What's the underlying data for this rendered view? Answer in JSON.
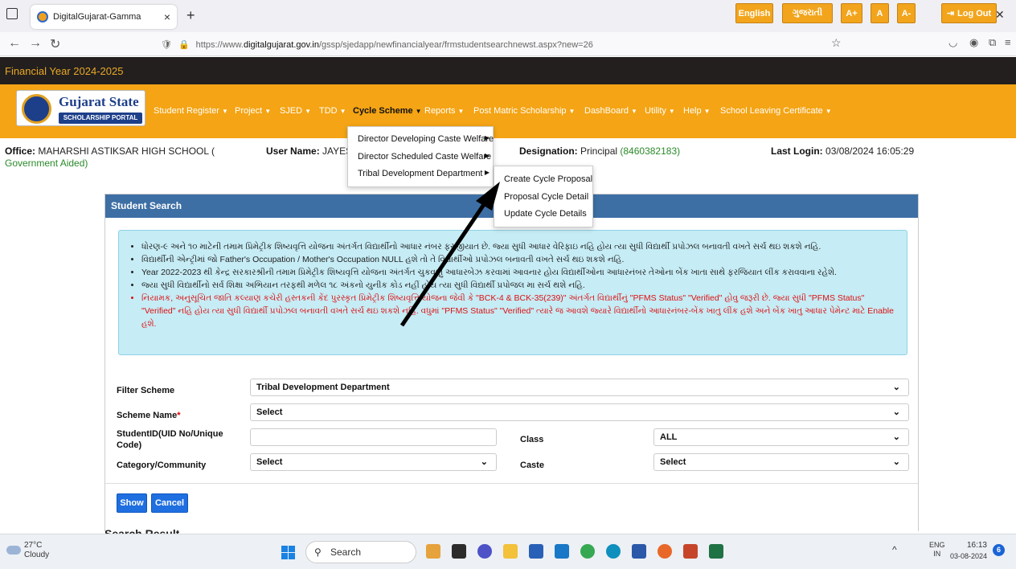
{
  "browser": {
    "tab_title": "DigitalGujarat-Gamma",
    "tab_close": "×",
    "new_tab": "+",
    "url_prefix": "https://www.",
    "url_domain": "digitalgujarat.gov.in",
    "url_path": "/gssp/sjedapp/newfinancialyear/frmstudentsearchnewst.aspx?new=26"
  },
  "topbar": {
    "financial_year": "Financial Year 2024-2025",
    "buttons": [
      "English",
      "ગુજરાતી",
      "A+",
      "A",
      "A-",
      "Log Out"
    ]
  },
  "logo": {
    "line1": "Gujarat State",
    "line2": "SCHOLARSHIP PORTAL"
  },
  "menu": [
    "Student Register",
    "Project",
    "SJED",
    "TDD",
    "Cycle Scheme",
    "Reports",
    "Post Matric Scholarship",
    "DashBoard",
    "Utility",
    "Help",
    "School Leaving Certificate"
  ],
  "dropdown_cycle": [
    "Director Developing Caste Welfare",
    "Director Scheduled Caste Welfare",
    "Tribal Development Department"
  ],
  "dropdown_tribal": [
    "Create Cycle Proposal",
    "Proposal Cycle Detail",
    "Update Cycle Details"
  ],
  "info": {
    "office_label": "Office:",
    "office_value": "MAHARSHI ASTIKSAR HIGH SCHOOL (",
    "office_type": "Government Aided)",
    "user_label": "User Name:",
    "user_value": "JAYESH",
    "designation_label": "Designation:",
    "designation_value": "Principal",
    "designation_phone": "(8460382183)",
    "last_login_label": "Last Login:",
    "last_login_value": "03/08/2024 16:05:29"
  },
  "panel": {
    "title": "Student Search",
    "notices": [
      "ધોરણ-૯ અને ૧૦ માટેની તમામ પ્રિમેટ્રીક શિષ્યવૃત્તિ યોજના અંતર્ગત વિદ્યાર્થીનો આધાર નંબર ફરજીયાત છે. જ્યા સુધી આધાર વેરિફાઇ નહિ હોય ત્યા સુધી વિદ્યાર્થી પ્રપોઝલ બનાવતી વખતે સર્ચ થઇ શકશે નહિ.",
      "વિદ્યાર્થીની એન્ટ્રીમાં જો Father's Occupation / Mother's Occupation NULL હશે તો તે વિદ્યાર્થીઓ પ્રપોઝલ બનાવતી વખતે સર્ચ થઇ શકશે નહિ.",
      "Year 2022-2023 થી કેન્દ્ર સરકારશ્રીની તમામ પ્રિમેટ્રીક શિષ્યવૃત્તિ યોજના અંતર્ગત ચુકવણું આધારબેઝ કરવામાં આવનાર હોય વિદ્યાર્થીઓના આધારનંબર તેઓના બેંક ખાતા સાથે ફરજિયાત લીંક કરાવવાના રહેશે.",
      "જ્યા સુધી વિદ્યાર્થીનો સર્વ શિક્ષા અભિયાન તરફથી મળેલ ૧૮ અંકનો યુનીક કોડ નહીં હોય ત્યા સુધી વિદ્યાર્થી પ્રપોજલ મા સર્ચ થશે નહિ.",
      "નિયામક, અનુસૂચિત જાતિ કલ્યાણ કચેરી હસ્તકની કેંદ પુરસ્કૃત પ્રિમેટ્રીક શિષ્યવૃત્તિ યોજના જેવી કે \"BCK-4 & BCK-35(239)\" અંતર્ગત વિદ્યાર્થીનું \"PFMS Status\" \"Verified\" હોવુ જરૂરી છે. જ્યા સુધી \"PFMS Status\" \"Verified\" નહિ હોય ત્યા સુધી વિદ્યાર્થી પ્રપોઝલ બનાવતી વખતે સર્ચ થઇ શકશે નહિ. વધુમાં \"PFMS Status\" \"Verified\" ત્યારે જ આવશે જ્યારે વિદ્યાર્થીનો આધારનંબર-બેંક ખાતુ લીંક હશે અને બેંક ખાતુ આધાર પેમેન્ટ માટે Enable હશે."
    ],
    "filter_scheme_label": "Filter Scheme",
    "filter_scheme_value": "Tribal Development Department",
    "scheme_name_label": "Scheme Name",
    "scheme_name_required": "*",
    "scheme_name_value": "Select",
    "student_id_label": "StudentID(UID No/Unique Code)",
    "student_id_value": "",
    "class_label": "Class",
    "class_value": "ALL",
    "category_label": "Category/Community",
    "category_value": "Select",
    "caste_label": "Caste",
    "caste_value": "Select",
    "show_button": "Show",
    "cancel_button": "Cancel",
    "search_result": "Search Result"
  },
  "taskbar": {
    "weather_temp": "27°C",
    "weather_desc": "Cloudy",
    "search_placeholder": "Search",
    "lang_top": "ENG",
    "lang_bottom": "IN",
    "time": "16:13",
    "date": "03-08-2024",
    "notif_count": "6"
  },
  "colors": {
    "topbar": "#231f1f",
    "menu_orange": "#f4a414",
    "panel_header": "#3d6fa5",
    "notice_bg": "#c6ecf5",
    "button_blue": "#1f6fe0"
  }
}
